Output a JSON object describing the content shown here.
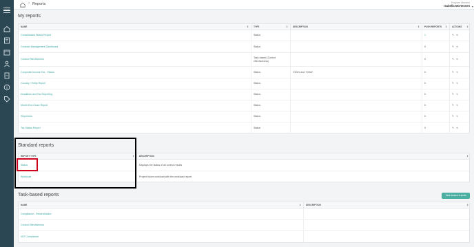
{
  "header": {
    "breadcrumb": "Reports",
    "user_role": "Program Member",
    "user_name": "Isabella Mortensen"
  },
  "sections": {
    "my_reports": "My reports",
    "standard_reports": "Standard reports",
    "task_based_reports": "Task-based reports"
  },
  "my_reports": {
    "columns": [
      "NAME",
      "TYPE",
      "DESCRIPTION",
      "PUSH REPORTS",
      "ACTIONS"
    ],
    "rows": [
      {
        "name": "Consolidated Status Report",
        "type": "Status",
        "description": "",
        "push": "1"
      },
      {
        "name": "Contract Management Dashboard",
        "type": "Status",
        "description": "",
        "push": "0"
      },
      {
        "name": "Control Effectiveness",
        "type": "Task-based (Control effectiveness)",
        "description": "",
        "push": "0"
      },
      {
        "name": "Corporate Income Tax - Status",
        "type": "Status",
        "description": "Y2021 and Y2022",
        "push": "0"
      },
      {
        "name": "Country / Entity Report",
        "type": "Status",
        "description": "",
        "push": "0"
      },
      {
        "name": "Deadlines and Tax Reporting",
        "type": "Status",
        "description": "",
        "push": "0"
      },
      {
        "name": "Month End Close Report",
        "type": "Status",
        "description": "",
        "push": "0"
      },
      {
        "name": "Shipments",
        "type": "Status",
        "description": "",
        "push": "0"
      },
      {
        "name": "Tax Status Report",
        "type": "Status",
        "description": "",
        "push": "0"
      }
    ],
    "actions": "✎ ✕"
  },
  "standard_reports": {
    "columns": [
      "REPORT TYPE",
      "DESCRIPTION"
    ],
    "rows": [
      {
        "name": "Status",
        "description": "Displays the status of all control results"
      },
      {
        "name": "Workload",
        "description": "Project future workload with the workload report"
      }
    ]
  },
  "task_based_reports": {
    "button": "Task-based reports",
    "columns": [
      "NAME",
      "DESCRIPTION"
    ],
    "rows": [
      {
        "name": "Compliance - Reconciliation",
        "description": ""
      },
      {
        "name": "Control Effectiveness",
        "description": ""
      },
      {
        "name": "VAT Compliance",
        "description": ""
      }
    ]
  },
  "icons": {
    "sidebar": [
      "menu-icon",
      "home-icon",
      "list-icon",
      "calendar-icon",
      "people-icon",
      "document-icon",
      "info-icon",
      "tag-icon"
    ]
  },
  "colors": {
    "sidebar": "#2b4753",
    "link": "#35a6a0",
    "accent_button": "#4aaea3",
    "highlight_red": "#d0021b"
  }
}
